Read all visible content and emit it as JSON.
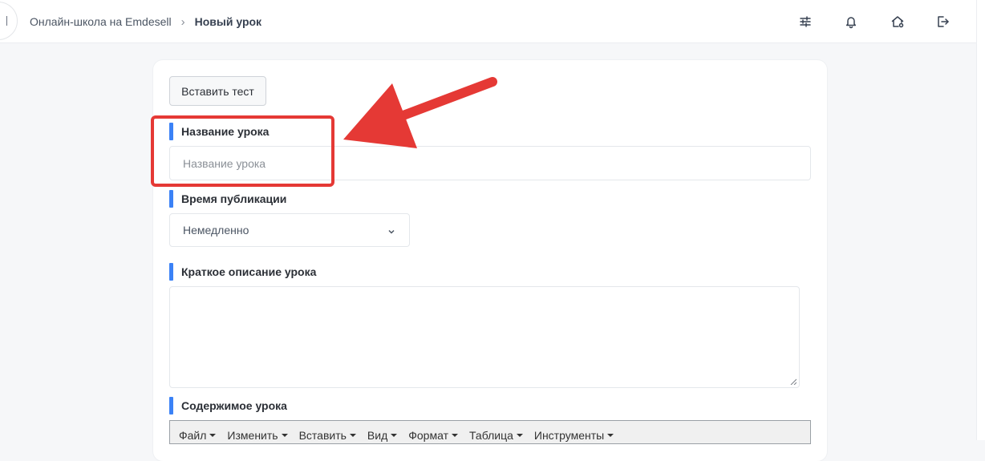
{
  "header": {
    "breadcrumb_parent": "Онлайн-школа на Emdesell",
    "breadcrumb_separator": "›",
    "breadcrumb_current": "Новый урок",
    "icons": [
      "sliders-icon",
      "bell-icon",
      "home-settings-icon",
      "logout-icon"
    ]
  },
  "form": {
    "insert_test_label": "Вставить тест",
    "title_label": "Название урока",
    "title_placeholder": "Название урока",
    "title_value": "",
    "publish_time_label": "Время публикации",
    "publish_time_value": "Немедленно",
    "short_description_label": "Краткое описание урока",
    "short_description_value": "",
    "content_label": "Содержимое урока"
  },
  "editor": {
    "menu": [
      "Файл",
      "Изменить",
      "Вставить",
      "Вид",
      "Формат",
      "Таблица",
      "Инструменты"
    ]
  },
  "annotation": {
    "highlight_color": "#e53935"
  },
  "colors": {
    "accent": "#3b82f6",
    "background": "#f6f7f9",
    "card": "#ffffff"
  }
}
